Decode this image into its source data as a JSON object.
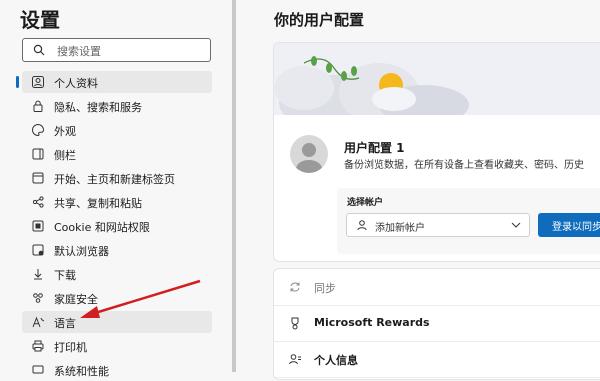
{
  "sidebar": {
    "title": "设置",
    "search": {
      "placeholder": "搜索设置",
      "value": ""
    },
    "items": [
      {
        "label": "个人资料",
        "icon": "profile-icon"
      },
      {
        "label": "隐私、搜索和服务",
        "icon": "lock-icon"
      },
      {
        "label": "外观",
        "icon": "appearance-icon"
      },
      {
        "label": "侧栏",
        "icon": "sidebar-icon"
      },
      {
        "label": "开始、主页和新建标签页",
        "icon": "home-icon"
      },
      {
        "label": "共享、复制和粘贴",
        "icon": "share-icon"
      },
      {
        "label": "Cookie 和网站权限",
        "icon": "cookie-icon"
      },
      {
        "label": "默认浏览器",
        "icon": "browser-icon"
      },
      {
        "label": "下载",
        "icon": "download-icon"
      },
      {
        "label": "家庭安全",
        "icon": "family-icon"
      },
      {
        "label": "语言",
        "icon": "language-icon"
      },
      {
        "label": "打印机",
        "icon": "printer-icon"
      },
      {
        "label": "系统和性能",
        "icon": "system-icon"
      }
    ]
  },
  "main": {
    "title": "你的用户配置",
    "profile": {
      "name": "用户配置 1",
      "description": "备份浏览数据，在所有设备上查看收藏夹、密码、历史"
    },
    "account": {
      "label": "选择帐户",
      "selected": "添加新帐户",
      "sync_button": "登录以同步"
    },
    "rows": [
      {
        "label": "同步",
        "icon": "sync-icon"
      },
      {
        "label": "Microsoft Rewards",
        "icon": "rewards-icon"
      },
      {
        "label": "个人信息",
        "icon": "personal-info-icon"
      }
    ]
  },
  "colors": {
    "accent": "#0f6cbd",
    "annotation_arrow": "#d11f1f",
    "sun": "#f5b81c"
  }
}
